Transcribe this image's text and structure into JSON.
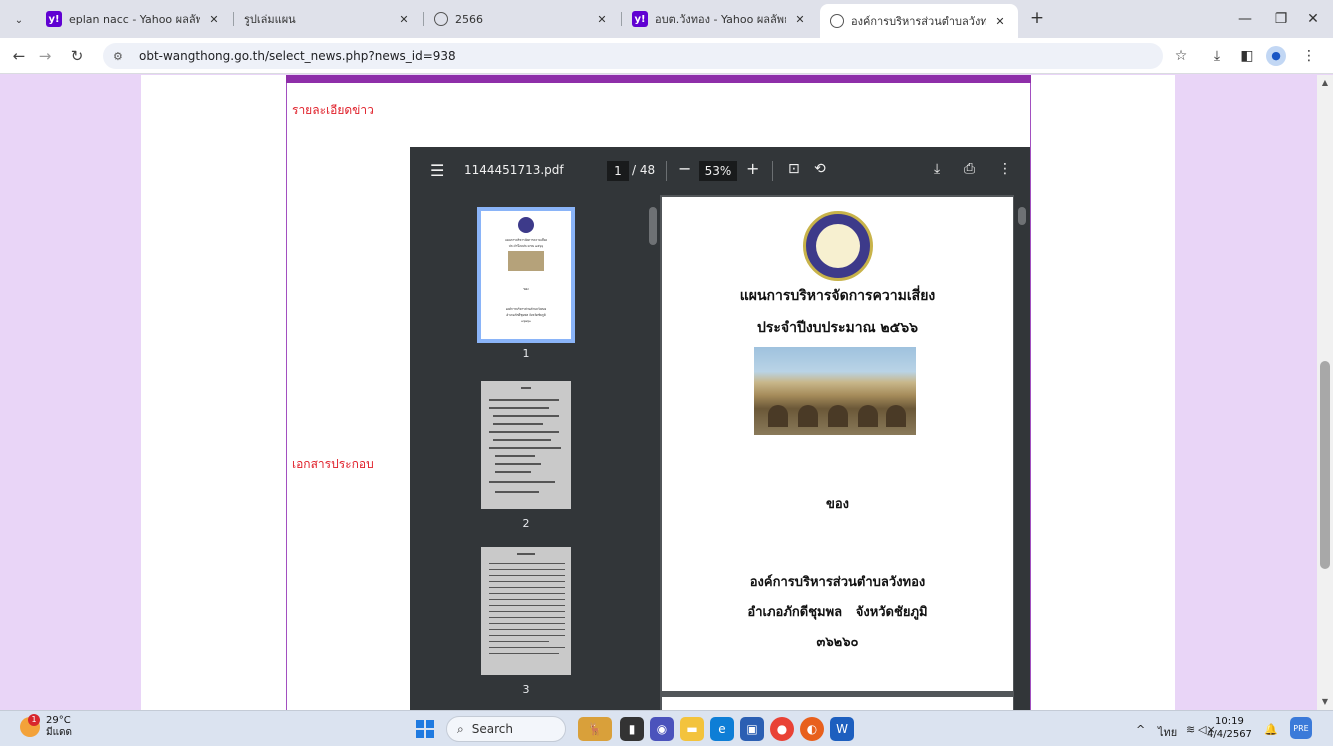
{
  "browser": {
    "tabs": [
      {
        "title": "eplan nacc - Yahoo ผลลัพธ์การค้…",
        "favicon": "yahoo-icon",
        "active": false
      },
      {
        "title": "รูปเล่มแผน",
        "favicon": "photo-icon",
        "active": false
      },
      {
        "title": "2566",
        "favicon": "globe-icon",
        "active": false
      },
      {
        "title": "อบต.วังทอง - Yahoo ผลลัพธ์การค้น",
        "favicon": "yahoo-icon",
        "active": false
      },
      {
        "title": "องค์การบริหารส่วนตำบลวังทอง อำเภ",
        "favicon": "globe-icon",
        "active": true
      }
    ],
    "url": "obt-wangthong.go.th/select_news.php?news_id=938"
  },
  "page": {
    "news_detail_label": "รายละเอียดข่าว",
    "attachment_label": "เอกสารประกอบ"
  },
  "pdf_viewer": {
    "filename": "1144451713.pdf",
    "current_page": "1",
    "total_pages": "/ 48",
    "zoom": "53%",
    "thumbnails": [
      "1",
      "2",
      "3"
    ],
    "document": {
      "title_line1": "แผนการบริหารจัดการความเสี่ยง",
      "title_line2": "ประจำปีงบประมาณ ๒๕๖๖",
      "of_label": "ของ",
      "org_name": "องค์การบริหารส่วนตำบลวังทอง",
      "district_line": "อำเภอภักดีชุมพล   จังหวัดชัยภูมิ",
      "postal_code": "๓๖๒๖๐",
      "thumb_title_line1": "แผนการบริหารจัดการความเสี่ยง",
      "thumb_title_line2": "ประจำปีงบประมาณ ๒๕๖๖",
      "thumb_of": "ของ",
      "thumb_org": "องค์การบริหารส่วนตำบลวังทอง",
      "thumb_district": "อำเภอภักดีชุมพล  จังหวัดชัยภูมิ",
      "thumb_postal": "๓๖๒๖๐"
    }
  },
  "taskbar": {
    "weather_temp": "29°C",
    "weather_desc": "มีแดด",
    "weather_badge": "1",
    "search_placeholder": "Search",
    "lang": "ไทย",
    "time": "10:19",
    "date": "4/4/2567"
  }
}
